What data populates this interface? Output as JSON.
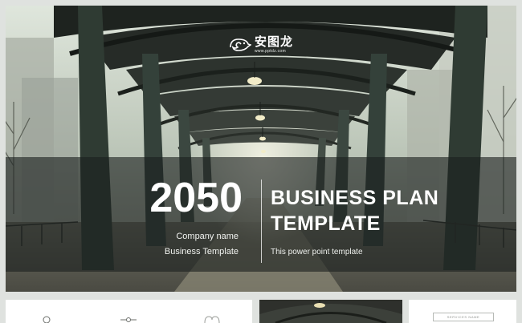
{
  "hero": {
    "logo": {
      "name": "安图龙",
      "url": "www.pptdz.com",
      "icon": "chameleon-logo-icon"
    },
    "year": "2050",
    "company_name": "Company name",
    "business_template": "Business Template",
    "title_line1": "BUSINESS PLAN",
    "title_line2": "TEMPLATE",
    "subtitle": "This power point template"
  },
  "thumbnails": {
    "thumb3_label": "SERVICES NAME",
    "thumb1_icons": [
      "search-icon",
      "pin-icon",
      "heart-icon"
    ]
  },
  "colors": {
    "band": "#1c211e",
    "text": "#ffffff",
    "background": "#dfe2df"
  }
}
